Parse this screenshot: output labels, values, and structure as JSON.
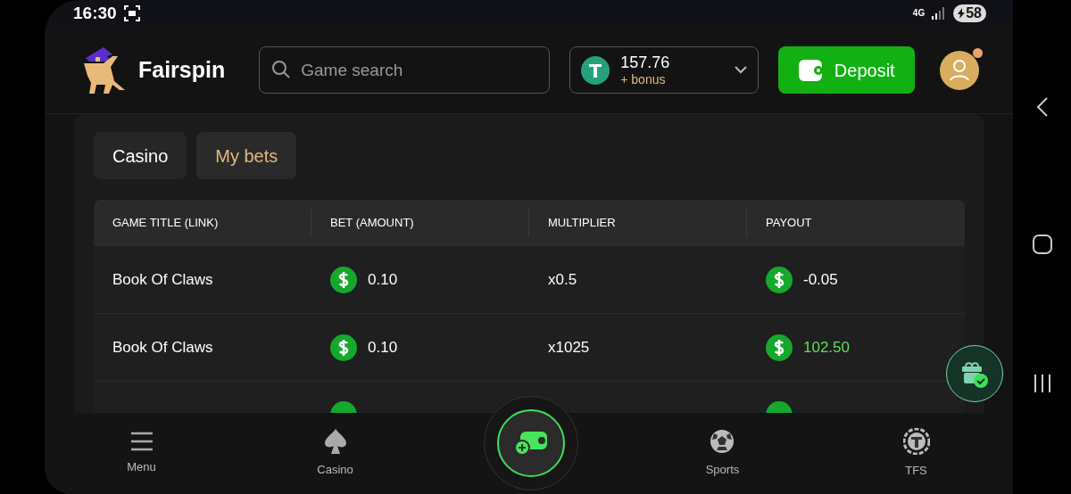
{
  "status_bar": {
    "time": "16:30",
    "network": "4G",
    "battery": "58"
  },
  "header": {
    "brand": "Fairspin",
    "search": {
      "placeholder": "Game search"
    },
    "balance": {
      "amount": "157.76",
      "bonus": "+ bonus"
    },
    "deposit_button": "Deposit"
  },
  "tabs": [
    {
      "label": "Casino",
      "selected": false
    },
    {
      "label": "My bets",
      "selected": true
    }
  ],
  "table": {
    "columns": [
      "GAME TITLE (LINK)",
      "BET (AMOUNT)",
      "MULTIPLIER",
      "PAYOUT"
    ],
    "rows": [
      {
        "game": "Book Of Claws",
        "bet": "0.10",
        "multiplier": "x0.5",
        "payout": "-0.05",
        "win": false
      },
      {
        "game": "Book Of Claws",
        "bet": "0.10",
        "multiplier": "x1025",
        "payout": "102.50",
        "win": true
      }
    ]
  },
  "bottom_nav": [
    {
      "kind": "menu",
      "label": "Menu"
    },
    {
      "kind": "casino",
      "label": "Casino"
    },
    {
      "kind": "wallet"
    },
    {
      "kind": "sports",
      "label": "Sports"
    },
    {
      "kind": "tfs",
      "label": "TFS"
    }
  ]
}
